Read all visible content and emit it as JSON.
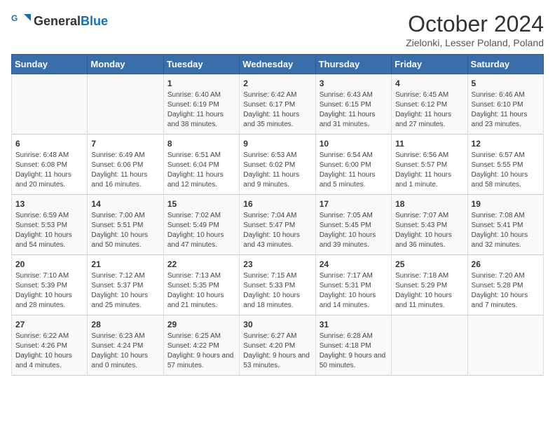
{
  "header": {
    "logo_general": "General",
    "logo_blue": "Blue",
    "month": "October 2024",
    "location": "Zielonki, Lesser Poland, Poland"
  },
  "days_of_week": [
    "Sunday",
    "Monday",
    "Tuesday",
    "Wednesday",
    "Thursday",
    "Friday",
    "Saturday"
  ],
  "weeks": [
    [
      {
        "day": "",
        "text": ""
      },
      {
        "day": "",
        "text": ""
      },
      {
        "day": "1",
        "text": "Sunrise: 6:40 AM\nSunset: 6:19 PM\nDaylight: 11 hours and 38 minutes."
      },
      {
        "day": "2",
        "text": "Sunrise: 6:42 AM\nSunset: 6:17 PM\nDaylight: 11 hours and 35 minutes."
      },
      {
        "day": "3",
        "text": "Sunrise: 6:43 AM\nSunset: 6:15 PM\nDaylight: 11 hours and 31 minutes."
      },
      {
        "day": "4",
        "text": "Sunrise: 6:45 AM\nSunset: 6:12 PM\nDaylight: 11 hours and 27 minutes."
      },
      {
        "day": "5",
        "text": "Sunrise: 6:46 AM\nSunset: 6:10 PM\nDaylight: 11 hours and 23 minutes."
      }
    ],
    [
      {
        "day": "6",
        "text": "Sunrise: 6:48 AM\nSunset: 6:08 PM\nDaylight: 11 hours and 20 minutes."
      },
      {
        "day": "7",
        "text": "Sunrise: 6:49 AM\nSunset: 6:06 PM\nDaylight: 11 hours and 16 minutes."
      },
      {
        "day": "8",
        "text": "Sunrise: 6:51 AM\nSunset: 6:04 PM\nDaylight: 11 hours and 12 minutes."
      },
      {
        "day": "9",
        "text": "Sunrise: 6:53 AM\nSunset: 6:02 PM\nDaylight: 11 hours and 9 minutes."
      },
      {
        "day": "10",
        "text": "Sunrise: 6:54 AM\nSunset: 6:00 PM\nDaylight: 11 hours and 5 minutes."
      },
      {
        "day": "11",
        "text": "Sunrise: 6:56 AM\nSunset: 5:57 PM\nDaylight: 11 hours and 1 minute."
      },
      {
        "day": "12",
        "text": "Sunrise: 6:57 AM\nSunset: 5:55 PM\nDaylight: 10 hours and 58 minutes."
      }
    ],
    [
      {
        "day": "13",
        "text": "Sunrise: 6:59 AM\nSunset: 5:53 PM\nDaylight: 10 hours and 54 minutes."
      },
      {
        "day": "14",
        "text": "Sunrise: 7:00 AM\nSunset: 5:51 PM\nDaylight: 10 hours and 50 minutes."
      },
      {
        "day": "15",
        "text": "Sunrise: 7:02 AM\nSunset: 5:49 PM\nDaylight: 10 hours and 47 minutes."
      },
      {
        "day": "16",
        "text": "Sunrise: 7:04 AM\nSunset: 5:47 PM\nDaylight: 10 hours and 43 minutes."
      },
      {
        "day": "17",
        "text": "Sunrise: 7:05 AM\nSunset: 5:45 PM\nDaylight: 10 hours and 39 minutes."
      },
      {
        "day": "18",
        "text": "Sunrise: 7:07 AM\nSunset: 5:43 PM\nDaylight: 10 hours and 36 minutes."
      },
      {
        "day": "19",
        "text": "Sunrise: 7:08 AM\nSunset: 5:41 PM\nDaylight: 10 hours and 32 minutes."
      }
    ],
    [
      {
        "day": "20",
        "text": "Sunrise: 7:10 AM\nSunset: 5:39 PM\nDaylight: 10 hours and 28 minutes."
      },
      {
        "day": "21",
        "text": "Sunrise: 7:12 AM\nSunset: 5:37 PM\nDaylight: 10 hours and 25 minutes."
      },
      {
        "day": "22",
        "text": "Sunrise: 7:13 AM\nSunset: 5:35 PM\nDaylight: 10 hours and 21 minutes."
      },
      {
        "day": "23",
        "text": "Sunrise: 7:15 AM\nSunset: 5:33 PM\nDaylight: 10 hours and 18 minutes."
      },
      {
        "day": "24",
        "text": "Sunrise: 7:17 AM\nSunset: 5:31 PM\nDaylight: 10 hours and 14 minutes."
      },
      {
        "day": "25",
        "text": "Sunrise: 7:18 AM\nSunset: 5:29 PM\nDaylight: 10 hours and 11 minutes."
      },
      {
        "day": "26",
        "text": "Sunrise: 7:20 AM\nSunset: 5:28 PM\nDaylight: 10 hours and 7 minutes."
      }
    ],
    [
      {
        "day": "27",
        "text": "Sunrise: 6:22 AM\nSunset: 4:26 PM\nDaylight: 10 hours and 4 minutes."
      },
      {
        "day": "28",
        "text": "Sunrise: 6:23 AM\nSunset: 4:24 PM\nDaylight: 10 hours and 0 minutes."
      },
      {
        "day": "29",
        "text": "Sunrise: 6:25 AM\nSunset: 4:22 PM\nDaylight: 9 hours and 57 minutes."
      },
      {
        "day": "30",
        "text": "Sunrise: 6:27 AM\nSunset: 4:20 PM\nDaylight: 9 hours and 53 minutes."
      },
      {
        "day": "31",
        "text": "Sunrise: 6:28 AM\nSunset: 4:18 PM\nDaylight: 9 hours and 50 minutes."
      },
      {
        "day": "",
        "text": ""
      },
      {
        "day": "",
        "text": ""
      }
    ]
  ]
}
